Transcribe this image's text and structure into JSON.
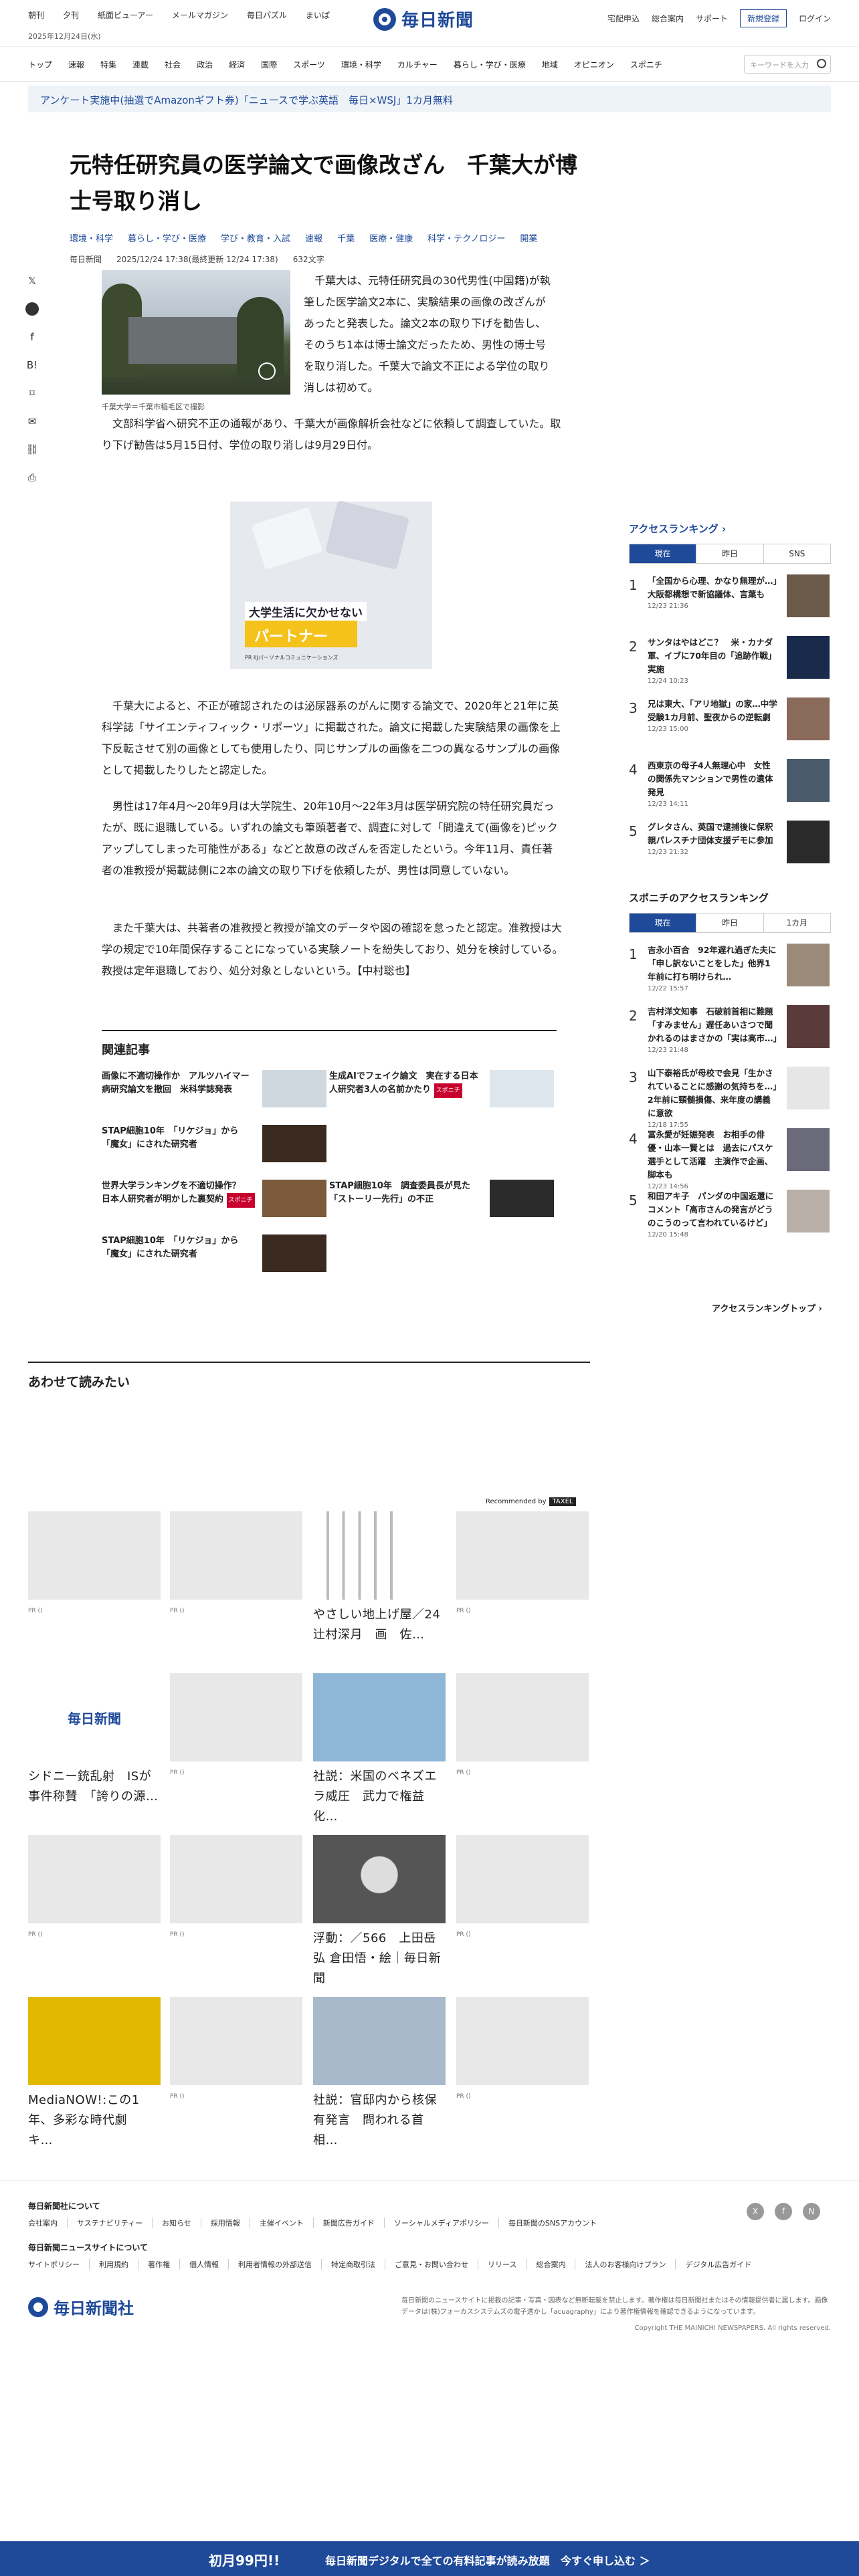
{
  "header": {
    "top_links": [
      "朝刊",
      "夕刊",
      "紙面ビューアー",
      "メールマガジン",
      "毎日パズル",
      "まいぱ"
    ],
    "date": "2025年12月24日(水)",
    "logo_text": "毎日新聞",
    "right_links": [
      "宅配申込",
      "総合案内",
      "サポート"
    ],
    "register_label": "新規登録",
    "login_label": "ログイン"
  },
  "nav": {
    "items": [
      "トップ",
      "速報",
      "特集",
      "連載",
      "社会",
      "政治",
      "経済",
      "国際",
      "スポーツ",
      "環境・科学",
      "カルチャー",
      "暮らし・学び・医療",
      "地域",
      "オピニオン",
      "スポニチ"
    ],
    "search_placeholder": "キーワードを入力"
  },
  "banner": {
    "text": "アンケート実施中(抽選でAmazonギフト券)「ニュースで学ぶ英語　毎日×WSJ」1カ月無料"
  },
  "article": {
    "title": "元特任研究員の医学論文で画像改ざん　千葉大が博士号取り消し",
    "tags": [
      "環境・科学",
      "暮らし・学び・医療",
      "学び・教育・入試",
      "速報",
      "千葉",
      "医療・健康",
      "科学・テクノロジー",
      "開業"
    ],
    "byline": "毎日新聞",
    "published": "2025/12/24 17:38(最終更新 12/24 17:38)",
    "chars": "632文字",
    "photo_caption": "千葉大学＝千葉市稲毛区で撮影",
    "p1": "千葉大は、元特任研究員の30代男性(中国籍)が執筆した医学論文2本に、実験結果の画像の改ざんがあったと発表した。論文2本の取り下げを勧告し、そのうち1本は博士論文だったため、男性の博士号を取り消した。千葉大で論文不正による学位の取り消しは初めて。",
    "p1b": "文部科学省へ研究不正の通報があり、千葉大が画像解析会社などに依頼して調査していた。取り下げ勧告は5月15日付、学位の取り消しは9月29日付。",
    "p2": "千葉大によると、不正が確認されたのは泌尿器系のがんに関する論文で、2020年と21年に英科学誌「サイエンティフィック・リポーツ」に掲載された。論文に掲載した実験結果の画像を上下反転させて別の画像としても使用したり、同じサンプルの画像を二つの異なるサンプルの画像として掲載したりしたと認定した。",
    "p3": "男性は17年4月～20年9月は大学院生、20年10月～22年3月は医学研究院の特任研究員だったが、既に退職している。いずれの論文も筆頭著者で、調査に対して「間違えて(画像を)ピックアップしてしまった可能性がある」などと故意の改ざんを否定したという。今年11月、責任著者の准教授が掲載誌側に2本の論文の取り下げを依頼したが、男性は同意していない。",
    "p4": "また千葉大は、共著者の准教授と教授が論文のデータや図の確認を怠ったと認定。准教授は大学の規定で10年間保存することになっている実験ノートを紛失しており、処分を検討している。教授は定年退職しており、処分対象としないという。【中村聡也】"
  },
  "ad": {
    "tag": "大学生活に欠かせない",
    "big": "パートナー",
    "sub": "PR  IIJパーソナルコミュニケーションズ"
  },
  "related": {
    "heading": "関連記事",
    "items": [
      {
        "title": "画像に不適切操作か　アルツハイマー病研究論文を撤回　米科学誌発表",
        "badge": ""
      },
      {
        "title": "生成AIでフェイク論文　実在する日本人研究者3人の名前かたり",
        "badge": "スポニチ"
      },
      {
        "title": "STAP細胞10年　「リケジョ」から「魔女」にされた研究者",
        "badge": ""
      },
      {
        "title": "",
        "badge": ""
      },
      {
        "title": "世界大学ランキングを不適切操作？　日本人研究者が明かした裏契約",
        "badge": "スポニチ"
      },
      {
        "title": "STAP細胞10年　調査委員長が見た「ストーリー先行」の不正",
        "badge": ""
      },
      {
        "title": "STAP細胞10年　「リケジョ」から「魔女」にされた研究者",
        "badge": ""
      }
    ]
  },
  "ranking": {
    "heading": "アクセスランキング",
    "tabs": [
      "現在",
      "昨日",
      "SNS"
    ],
    "items": [
      {
        "n": "1",
        "title": "「全国から心理、かなり無理が…」大阪都構想で新協議体、言葉も",
        "date": "12/23 21:36"
      },
      {
        "n": "2",
        "title": "サンタはやはどこ？　米・カナダ軍、イブに70年目の「追跡作戦」実施",
        "date": "12/24 10:23"
      },
      {
        "n": "3",
        "title": "兄は東大、「アリ地獄」の家…中学受験1カ月前、聖夜からの逆転劇",
        "date": "12/23 15:00"
      },
      {
        "n": "4",
        "title": "西東京の母子4人無理心中　女性の関係先マンションで男性の遺体発見",
        "date": "12/23 14:11"
      },
      {
        "n": "5",
        "title": "グレタさん、英国で逮捕後に保釈　親パレスチナ団体支援デモに参加",
        "date": "12/23 21:32"
      }
    ]
  },
  "sponichi": {
    "heading": "スポニチのアクセスランキング",
    "tabs": [
      "現在",
      "昨日",
      "1カ月"
    ],
    "items": [
      {
        "n": "1",
        "title": "吉永小百合　92年遅れ過ぎた夫に「申し訳ないことをした」他界1年前に打ち明けられ…",
        "date": "12/22 15:57"
      },
      {
        "n": "2",
        "title": "吉村洋文知事　石破前首相に難題「すみません」遅任あいさつで聞かれるのはまさかの「実は高市…」",
        "date": "12/23 21:48"
      },
      {
        "n": "3",
        "title": "山下泰裕氏が母校で会見「生かされていることに感謝の気持ちを…」2年前に頸髄損傷、来年度の講義に意欲",
        "date": "12/18 17:55"
      },
      {
        "n": "4",
        "title": "冨永愛が妊娠発表　お相手の俳優・山本一賢とは　過去にパスケ選手として活躍　主演作で企画、脚本も",
        "date": "12/23 14:56"
      },
      {
        "n": "5",
        "title": "和田アキ子　パンダの中国返還にコメント「高市さんの発言がどうのこうのって言われているけど」",
        "date": "12/20 15:48"
      }
    ],
    "more_label": "アクセスランキングトップ"
  },
  "recommend": {
    "heading": "あわせて読みたい",
    "recommended_by": "Recommended by",
    "brand": "TAXEL",
    "cards": [
      {
        "title": "",
        "label": "PR ()"
      },
      {
        "title": "",
        "label": "PR ()"
      },
      {
        "title": "やさしい地上げ屋／24　辻村深月　画　佐…",
        "label": ""
      },
      {
        "title": "",
        "label": "PR ()"
      },
      {
        "title": "シドニー銃乱射　ISが事件称賛　「誇りの源…",
        "label": ""
      },
      {
        "title": "",
        "label": "PR ()"
      },
      {
        "title": "社説：米国のベネズエラ威圧　武力で権益化…",
        "label": ""
      },
      {
        "title": "",
        "label": "PR ()"
      },
      {
        "title": "",
        "label": "PR ()"
      },
      {
        "title": "",
        "label": "PR ()"
      },
      {
        "title": "浮動：／566　上田岳弘 倉田悟・絵｜毎日新聞",
        "label": ""
      },
      {
        "title": "",
        "label": "PR ()"
      },
      {
        "title": "MediaNOW!:この1年、多彩な時代劇　キ…",
        "label": ""
      },
      {
        "title": "",
        "label": "PR ()"
      },
      {
        "title": "社説：官邸内から核保有発言　問われる首相…",
        "label": ""
      },
      {
        "title": "",
        "label": "PR ()"
      }
    ]
  },
  "footer": {
    "about": "毎日新聞社について",
    "about_links": [
      "会社案内",
      "サステナビリティー",
      "お知らせ",
      "採用情報",
      "主催イベント",
      "新聞広告ガイド",
      "ソーシャルメディアポリシー",
      "毎日新聞のSNSアカウント"
    ],
    "site": "毎日新聞ニュースサイトについて",
    "site_links": [
      "サイトポリシー",
      "利用規約",
      "著作権",
      "個人情報",
      "利用者情報の外部送信",
      "特定商取引法",
      "ご意見・お問い合わせ",
      "リリース",
      "総合案内",
      "法人のお客様向けプラン",
      "デジタル広告ガイド"
    ],
    "social": [
      "X",
      "f",
      "N"
    ],
    "logo_text": "毎日新聞社",
    "note": "毎日新聞のニュースサイトに掲載の記事・写真・図表など無断転載を禁止します。著作権は毎日新聞社またはその情報提供者に属します。画像データは(株)フォーカスシステムズの電子透かし「acuagraphy」により著作権情報を確認できるようになっています。",
    "copyright": "Copyright THE MAINICHI NEWSPAPERS. All rights reserved."
  },
  "cta": {
    "price": "初月99円!!",
    "text": "毎日新聞デジタルで全ての有料記事が読み放題",
    "action": "今すぐ申し込む ＞"
  }
}
